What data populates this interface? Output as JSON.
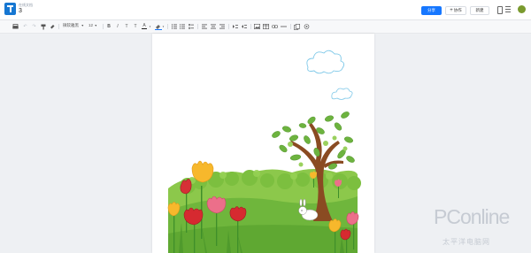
{
  "header": {
    "doc_subtitle": "在线文档",
    "doc_title": "3",
    "share_label": "分享",
    "collab_icon": "plus-icon",
    "collab_label": "协作",
    "new_label": "新建"
  },
  "toolbar": {
    "font_name": "微软雅黑",
    "font_size": "12",
    "icons": [
      "print-icon",
      "undo-icon",
      "redo-icon",
      "format-painter-icon",
      "clear-format-icon",
      "bold-icon",
      "italic-icon",
      "underline-icon",
      "strikethrough-icon",
      "font-color-icon",
      "highlight-icon",
      "ordered-list-icon",
      "unordered-list-icon",
      "checklist-icon",
      "align-left-icon",
      "align-center-icon",
      "align-right-icon",
      "indent-icon",
      "outdent-icon",
      "image-icon",
      "table-icon",
      "link-icon",
      "divider-icon",
      "attachment-icon",
      "more-icon"
    ]
  },
  "watermark": {
    "logo": "PConline",
    "sub": "太平洋电脑网"
  },
  "colors": {
    "primary": "#1677ff",
    "grass": "#6fb63c",
    "tree_trunk": "#8a4b22"
  }
}
